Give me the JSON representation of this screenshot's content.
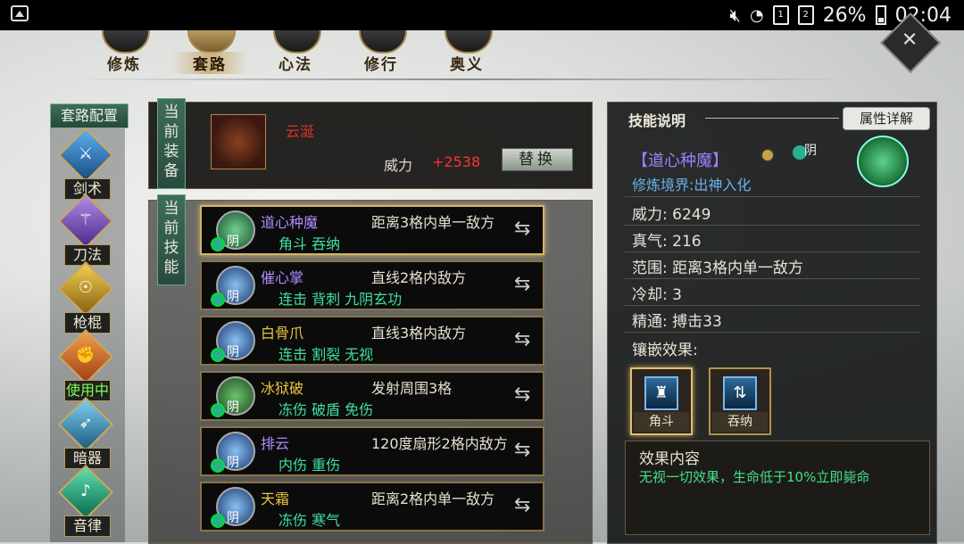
{
  "status_bar": {
    "battery_percent": "26%",
    "time": "02:04",
    "icons": [
      "gallery-icon",
      "mute-icon",
      "wifi-icon",
      "sim1-icon",
      "sim2-icon",
      "battery-icon"
    ]
  },
  "top_tabs": [
    {
      "label": "修炼",
      "active": false
    },
    {
      "label": "套路",
      "active": true
    },
    {
      "label": "心法",
      "active": false
    },
    {
      "label": "修行",
      "active": false
    },
    {
      "label": "奥义",
      "active": false
    }
  ],
  "close_button": {
    "icon": "close-icon",
    "glyph": "✕"
  },
  "left_panel": {
    "title": "套路配置",
    "categories": [
      {
        "label": "剑术",
        "icon": "sword-icon",
        "glyph": "⚔",
        "color": "#2a7fd0",
        "active": false
      },
      {
        "label": "刀法",
        "icon": "blade-icon",
        "glyph": "⚚",
        "color": "#7a4ac8",
        "active": false
      },
      {
        "label": "枪棍",
        "icon": "spear-icon",
        "glyph": "☉",
        "color": "#c8a020",
        "active": false
      },
      {
        "label": "使用中",
        "icon": "fist-icon",
        "glyph": "✊",
        "color": "#d07020",
        "active": true
      },
      {
        "label": "暗器",
        "icon": "dart-icon",
        "glyph": "➶",
        "color": "#3a9ac0",
        "active": false
      },
      {
        "label": "音律",
        "icon": "music-icon",
        "glyph": "♪",
        "color": "#2ab090",
        "active": false
      }
    ]
  },
  "equipment": {
    "tag": "当前装备",
    "name": "云涎",
    "power_label": "威力",
    "power_value": "+2538",
    "replace_label": "替换",
    "icon": "gauntlet-icon"
  },
  "skills": {
    "tag": "当前技能",
    "items": [
      {
        "name": "道心种魔",
        "name_color": "#b08cff",
        "range": "距离3格内单一敌方",
        "tags": "角斗  吞纳",
        "yin": "阴",
        "icon_color": "#3aa060",
        "selected": true
      },
      {
        "name": "催心掌",
        "name_color": "#b08cff",
        "range": "直线2格内敌方",
        "tags": "连击  背刺  九阴玄功",
        "yin": "阴",
        "icon_color": "#4a8ad0",
        "selected": false
      },
      {
        "name": "白骨爪",
        "name_color": "#e8c640",
        "range": "直线3格内敌方",
        "tags": "连击  割裂  无视",
        "yin": "阴",
        "icon_color": "#4a8ad0",
        "selected": false
      },
      {
        "name": "冰狱破",
        "name_color": "#e8c640",
        "range": "发射周围3格",
        "tags": "冻伤  破盾  免伤",
        "yin": "阴",
        "icon_color": "#3a9a50",
        "selected": false
      },
      {
        "name": "排云",
        "name_color": "#b08cff",
        "range": "120度扇形2格内敌方",
        "tags": "内伤  重伤",
        "yin": "阴",
        "icon_color": "#4a8ad0",
        "selected": false
      },
      {
        "name": "天霜",
        "name_color": "#e8c640",
        "range": "距离2格内单一敌方",
        "tags": "冻伤  寒气",
        "yin": "阴",
        "icon_color": "#3a7ad0",
        "selected": false
      }
    ]
  },
  "skill_info": {
    "title": "技能说明",
    "attr_detail_label": "属性详解",
    "skill_name": "【道心种魔】",
    "yin_label": "阴",
    "level": "修炼境界:出神入化",
    "stats": [
      {
        "label": "威力:",
        "value": "6249"
      },
      {
        "label": "真气:",
        "value": "216"
      },
      {
        "label": "范围:",
        "value": "距离3格内单一敌方"
      },
      {
        "label": "冷却:",
        "value": "3"
      },
      {
        "label": "精通:",
        "value": "搏击33"
      }
    ],
    "inlay_label": "镶嵌效果:",
    "inlays": [
      {
        "label": "角斗",
        "glyph": "♜",
        "selected": true
      },
      {
        "label": "吞纳",
        "glyph": "⇅",
        "selected": false
      }
    ],
    "effect_title": "效果内容",
    "effect_text": "无视一切效果，生命低于10%立即毙命"
  }
}
